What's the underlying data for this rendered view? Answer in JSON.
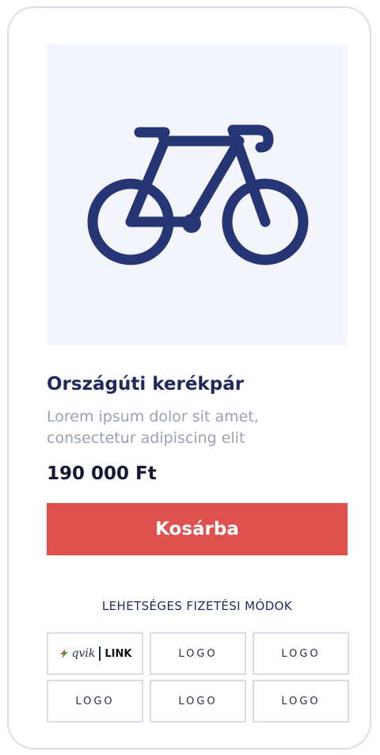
{
  "product": {
    "image_icon": "bicycle-icon",
    "title": "Országúti kerékpár",
    "description": "Lorem ipsum dolor sit amet, consectetur adipiscing elit",
    "price": "190 000 Ft"
  },
  "cart_button": {
    "label": "Kosárba"
  },
  "payment": {
    "title": "LEHETSÉGES FIZETÉSI MÓDOK",
    "qvik_logo": {
      "word": "qvik",
      "link": "LINK"
    },
    "logos": [
      "LOGO",
      "LOGO",
      "LOGO",
      "LOGO",
      "LOGO"
    ]
  },
  "colors": {
    "icon": "#263573",
    "button": "#e0504c",
    "title": "#1f2a5c",
    "muted_text": "#9aa1b4",
    "image_background": "#f3f5fa"
  }
}
